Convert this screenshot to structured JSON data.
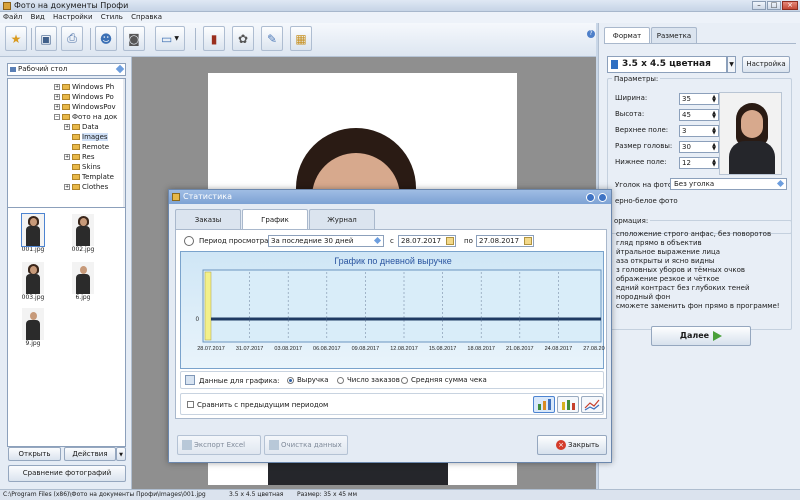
{
  "window": {
    "title": "Фото на документы Профи"
  },
  "menu": [
    "Файл",
    "Вид",
    "Настройки",
    "Стиль",
    "Справка"
  ],
  "toolbar": {
    "buttons": [
      "open-icon",
      "save-icon",
      "print-icon",
      "portrait-icon",
      "camera-icon",
      "display-icon",
      "help-book-icon",
      "film-reel-icon",
      "tools-icon",
      "box-icon"
    ]
  },
  "left": {
    "folder": "Рабочий стол",
    "tree": [
      {
        "label": "Windows Ph",
        "depth": 3,
        "expander": "+"
      },
      {
        "label": "Windows Po",
        "depth": 3,
        "expander": "+"
      },
      {
        "label": "WindowsPov",
        "depth": 3,
        "expander": "+"
      },
      {
        "label": "Фото на док",
        "depth": 3,
        "expander": "−"
      },
      {
        "label": "Data",
        "depth": 4,
        "expander": "+"
      },
      {
        "label": "Images",
        "depth": 4,
        "expander": "",
        "selected": true
      },
      {
        "label": "Remote",
        "depth": 4,
        "expander": ""
      },
      {
        "label": "Res",
        "depth": 4,
        "expander": "+"
      },
      {
        "label": "Skins",
        "depth": 4,
        "expander": ""
      },
      {
        "label": "Template",
        "depth": 4,
        "expander": ""
      },
      {
        "label": "Clothes",
        "depth": 4,
        "expander": "+"
      }
    ],
    "thumbs": [
      "001.jpg",
      "002.jpg",
      "003.jpg",
      "6.jpg",
      "9.jpg"
    ],
    "open_label": "Открыть",
    "actions_label": "Действия",
    "compare_label": "Сравнение фотографий"
  },
  "right": {
    "tabs": [
      "Формат",
      "Разметка"
    ],
    "format": "3.5 x 4.5 цветная",
    "settings_label": "Настройка",
    "params_title": "Параметры:",
    "params": [
      {
        "label": "Ширина:",
        "value": "35"
      },
      {
        "label": "Высота:",
        "value": "45"
      },
      {
        "label": "Верхнее поле:",
        "value": "3"
      },
      {
        "label": "Размер головы:",
        "value": "30"
      },
      {
        "label": "Нижнее поле:",
        "value": "12"
      }
    ],
    "corner_label": "Уголок на фото:",
    "corner_value": "Без уголка",
    "bw_label": "ерно-белое фото",
    "info_title": "ормация:",
    "info": [
      "сположение строго анфас, без поворотов",
      "гляд прямо в объектив",
      "йтральное выражение лица",
      "аза открыты и ясно видны",
      "з головных уборов и тёмных очков",
      "ображение резкое и чёткое",
      "едний контраст без глубоких теней",
      "нородный фон",
      "сможете заменить фон прямо в программе!"
    ],
    "next_label": "Далее"
  },
  "dialog": {
    "title": "Статистика",
    "tabs": [
      "Заказы",
      "График",
      "Журнал"
    ],
    "period_label": "Период просмотра:",
    "period_value": "За последние 30 дней",
    "from_label": "с",
    "from_date": "28.07.2017",
    "to_label": "по",
    "to_date": "27.08.2017",
    "data_label": "Данные для графика:",
    "radio": [
      "Выручка",
      "Число заказов",
      "Средняя сумма чека"
    ],
    "compare_label": "Сравнить с предыдущим периодом",
    "export_label": "Экспорт Excel",
    "clear_label": "Очистка данных",
    "close_label": "Закрыть"
  },
  "chart_data": {
    "type": "bar",
    "title": "График по дневной выручке",
    "x": [
      "28.07.2017",
      "31.07.2017",
      "03.08.2017",
      "06.08.2017",
      "09.08.2017",
      "12.08.2017",
      "15.08.2017",
      "18.08.2017",
      "21.08.2017",
      "24.08.2017",
      "27.08.2017"
    ],
    "series": [
      {
        "values": [
          0,
          0,
          0,
          0,
          0,
          0,
          0,
          0,
          0,
          0,
          0
        ]
      }
    ],
    "y_ticks": [
      "0"
    ],
    "colors": {
      "bar": "#1f3a63",
      "background": "#d9edf9",
      "highlight": "#f3f08a"
    },
    "grid": true
  },
  "status": {
    "path": "C:\\Program Files (x86)\\Фото на документы Профи\\Images\\001.jpg",
    "format": "3.5 x 4.5 цветная",
    "size": "Размер: 35 x 45 мм"
  }
}
